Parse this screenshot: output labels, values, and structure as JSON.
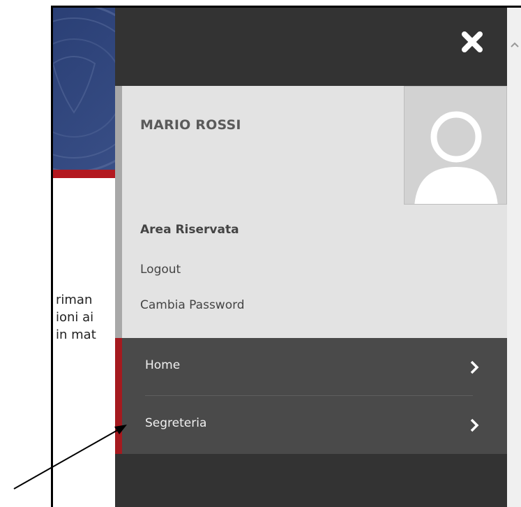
{
  "background": {
    "text_lines": [
      "riman",
      "ioni ai",
      "in mat"
    ]
  },
  "panel": {
    "user_name": "MARIO ROSSI",
    "area_title": "Area Riservata",
    "links": [
      "Logout",
      "Cambia Password"
    ],
    "close_icon": "close-icon",
    "avatar_icon": "user-avatar-icon"
  },
  "menu": {
    "items": [
      {
        "label": "Home",
        "icon": "chevron-right-icon"
      },
      {
        "label": "Segreteria",
        "icon": "chevron-right-icon"
      }
    ]
  },
  "colors": {
    "panel_bg": "#333333",
    "profile_bg": "#e3e3e3",
    "menu_bg": "#4a4a4a",
    "accent_red": "#a51a1f",
    "banner_blue": "#2a3f75"
  }
}
